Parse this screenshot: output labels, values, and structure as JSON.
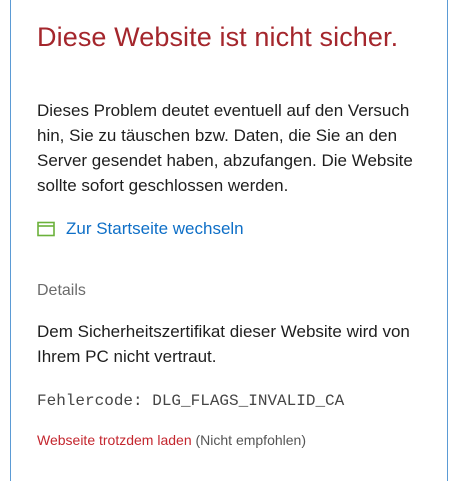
{
  "error_page": {
    "title": "Diese Website ist nicht sicher.",
    "description": "Dieses Problem deutet eventuell auf den Versuch hin, Sie zu täuschen bzw. Daten, die Sie an den Server gesendet haben, abzufangen. Die Website sollte sofort geschlossen werden.",
    "home_link": {
      "icon": "browser-window-icon",
      "label": "Zur Startseite wechseln"
    },
    "details": {
      "heading": "Details",
      "text": "Dem Sicherheitszertifikat dieser Website wird von Ihrem PC nicht vertraut.",
      "error_code": "Fehlercode: DLG_FLAGS_INVALID_CA"
    },
    "override": {
      "link_label": "Webseite trotzdem laden",
      "note": " (Nicht empfohlen)"
    }
  },
  "colors": {
    "title": "#a4262c",
    "link": "#0e6fc7",
    "override_link": "#c4262e",
    "icon_green": "#6bb13a",
    "frame_border": "#5b9bd5"
  }
}
